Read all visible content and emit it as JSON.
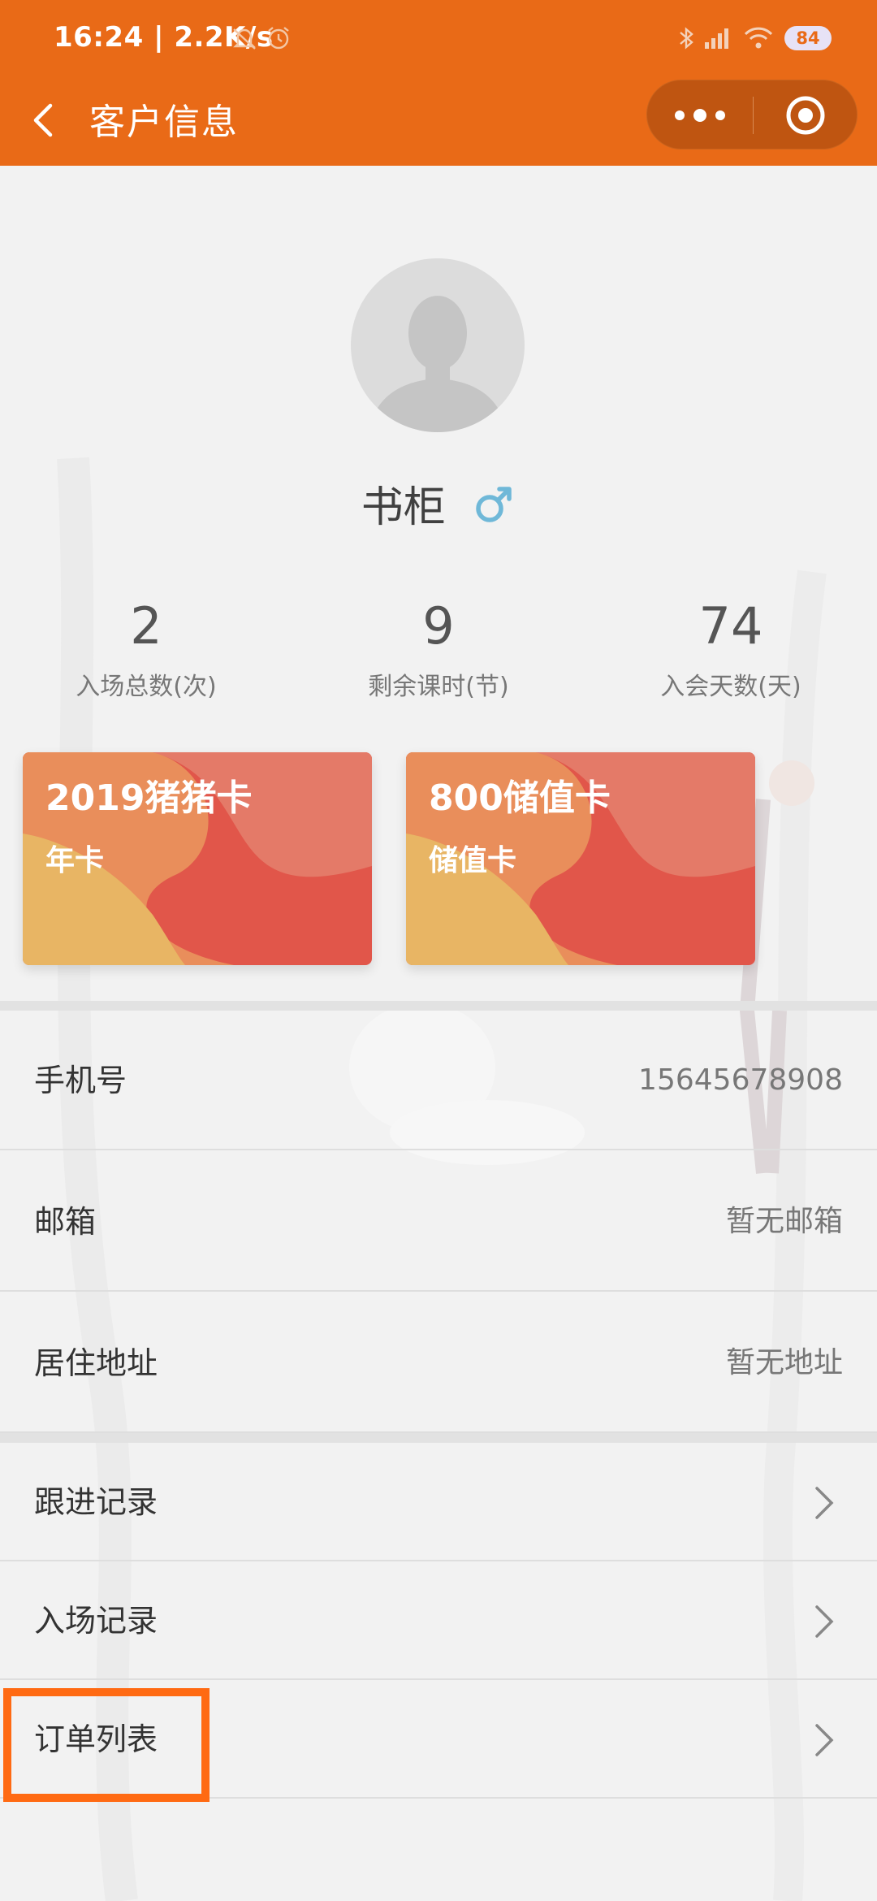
{
  "status_bar": {
    "time": "16:24 | 2.2K/s",
    "battery": "84"
  },
  "header": {
    "title": "客户信息"
  },
  "profile": {
    "name": "书柜",
    "gender_icon": "male-icon"
  },
  "stats": [
    {
      "value": "2",
      "label": "入场总数(次)"
    },
    {
      "value": "9",
      "label": "剩余课时(节)"
    },
    {
      "value": "74",
      "label": "入会天数(天)"
    }
  ],
  "cards": [
    {
      "title": "2019猪猪卡",
      "type": "年卡"
    },
    {
      "title": "800储值卡",
      "type": "储值卡"
    }
  ],
  "info": {
    "phone_label": "手机号",
    "phone_value": "15645678908",
    "email_label": "邮箱",
    "email_value": "暂无邮箱",
    "address_label": "居住地址",
    "address_value": "暂无地址"
  },
  "nav": [
    {
      "label": "跟进记录"
    },
    {
      "label": "入场记录"
    },
    {
      "label": "订单列表"
    }
  ],
  "colors": {
    "accent": "#e96a17",
    "highlight": "#ff6a13",
    "male": "#6fb8d8"
  }
}
